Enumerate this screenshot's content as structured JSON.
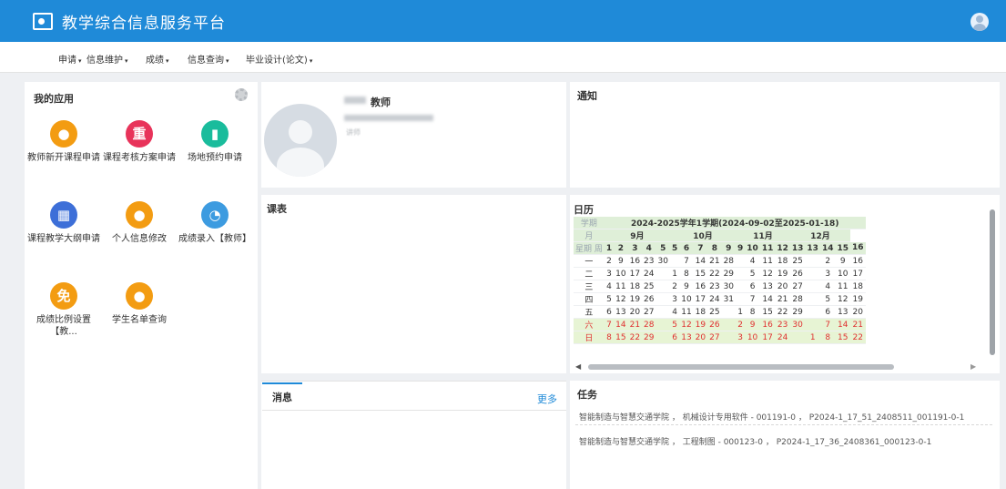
{
  "header": {
    "title": "教学综合信息服务平台",
    "logo_icon": "monitor-user-icon",
    "user_icon": "user-avatar-icon"
  },
  "menu": [
    {
      "label": "申请"
    },
    {
      "label": "信息维护"
    },
    {
      "label": "成绩"
    },
    {
      "label": "信息查询"
    },
    {
      "label": "毕业设计(论文)"
    }
  ],
  "apps_panel": {
    "title": "我的应用",
    "settings_icon": "gear-icon",
    "apps": [
      {
        "label": "教师新开课程申请",
        "glyph": "",
        "color": "#f39c12"
      },
      {
        "label": "课程考核方案申请",
        "glyph": "重",
        "color": "#e8335a"
      },
      {
        "label": "场地预约申请",
        "glyph": "",
        "color": "#1abc9c"
      },
      {
        "label": "课程教学大纲申请",
        "glyph": "",
        "color": "#3d6fd8"
      },
      {
        "label": "个人信息修改",
        "glyph": "",
        "color": "#f39c12"
      },
      {
        "label": "成绩录入【教师】",
        "glyph": "",
        "color": "#3d9be0"
      },
      {
        "label": "成绩比例设置【教...",
        "glyph": "免",
        "color": "#f39c12"
      },
      {
        "label": "学生名单查询",
        "glyph": "",
        "color": "#f39c12"
      }
    ]
  },
  "profile": {
    "role": "教师",
    "subtitle": "讲师"
  },
  "notice": {
    "title": "通知"
  },
  "schedule": {
    "title": "课表"
  },
  "calendar": {
    "title": "日历",
    "corner_top": "学期",
    "corner_mid": "月",
    "corner_week": "周",
    "corner_weekday": "星期",
    "term_label": "2024-2025学年1学期(2024-09-02至2025-01-18)",
    "months": [
      {
        "label": "9月",
        "span": 5
      },
      {
        "label": "10月",
        "span": 5
      },
      {
        "label": "11月",
        "span": 4
      },
      {
        "label": "12月",
        "span": 4
      }
    ],
    "weeks": [
      "1",
      "2",
      "3",
      "4",
      "5",
      "5",
      "6",
      "7",
      "8",
      "9",
      "9",
      "10",
      "11",
      "12",
      "13",
      "13",
      "14",
      "15",
      "16"
    ],
    "rows": [
      {
        "day": "一",
        "cells": [
          "2",
          "9",
          "16",
          "23",
          "30",
          "",
          "7",
          "14",
          "21",
          "28",
          "",
          "4",
          "11",
          "18",
          "25",
          "",
          "2",
          "9",
          "16"
        ],
        "weekend": false
      },
      {
        "day": "二",
        "cells": [
          "3",
          "10",
          "17",
          "24",
          "",
          "1",
          "8",
          "15",
          "22",
          "29",
          "",
          "5",
          "12",
          "19",
          "26",
          "",
          "3",
          "10",
          "17"
        ],
        "weekend": false
      },
      {
        "day": "三",
        "cells": [
          "4",
          "11",
          "18",
          "25",
          "",
          "2",
          "9",
          "16",
          "23",
          "30",
          "",
          "6",
          "13",
          "20",
          "27",
          "",
          "4",
          "11",
          "18"
        ],
        "weekend": false
      },
      {
        "day": "四",
        "cells": [
          "5",
          "12",
          "19",
          "26",
          "",
          "3",
          "10",
          "17",
          "24",
          "31",
          "",
          "7",
          "14",
          "21",
          "28",
          "",
          "5",
          "12",
          "19"
        ],
        "weekend": false
      },
      {
        "day": "五",
        "cells": [
          "6",
          "13",
          "20",
          "27",
          "",
          "4",
          "11",
          "18",
          "25",
          "",
          "1",
          "8",
          "15",
          "22",
          "29",
          "",
          "6",
          "13",
          "20"
        ],
        "weekend": false
      },
      {
        "day": "六",
        "cells": [
          "7",
          "14",
          "21",
          "28",
          "",
          "5",
          "12",
          "19",
          "26",
          "",
          "2",
          "9",
          "16",
          "23",
          "30",
          "",
          "7",
          "14",
          "21"
        ],
        "weekend": true
      },
      {
        "day": "日",
        "cells": [
          "8",
          "15",
          "22",
          "29",
          "",
          "6",
          "13",
          "20",
          "27",
          "",
          "3",
          "10",
          "17",
          "24",
          "",
          "1",
          "8",
          "15",
          "22"
        ],
        "weekend": true
      }
    ]
  },
  "messages": {
    "tab_label": "消息",
    "more_label": "更多"
  },
  "tasks": {
    "title": "任务",
    "items": [
      "智能制造与智慧交通学院 ， 机械设计专用软件 - 001191-0 ， P2024-1_17_51_2408511_001191-0-1",
      "智能制造与智慧交通学院 ， 工程制图 - 000123-0 ， P2024-1_17_36_2408361_000123-0-1"
    ]
  }
}
